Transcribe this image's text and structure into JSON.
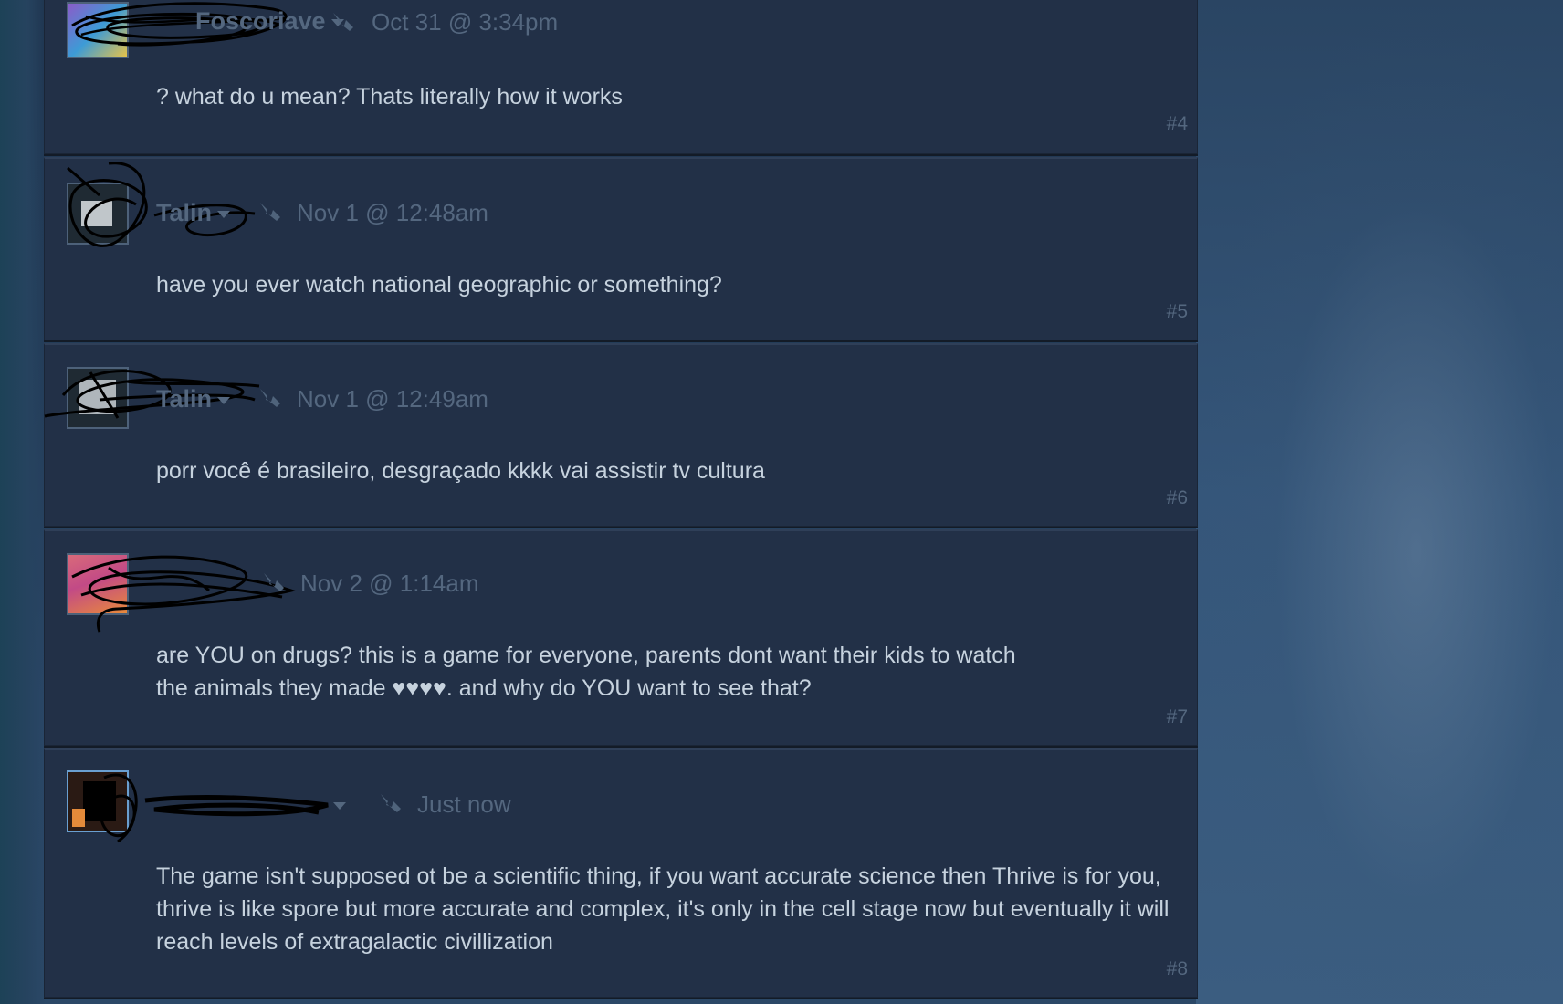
{
  "posts": [
    {
      "author": "Foscoriave",
      "timestamp": "Oct 31 @ 3:34pm",
      "text": "? what do u mean? Thats literally how it works",
      "number": "#4",
      "avatar_color": "#8a5cc9"
    },
    {
      "author": "Talin",
      "timestamp": "Nov 1 @ 12:48am",
      "text": "have you ever watch national geographic or something?",
      "number": "#5",
      "avatar_color": "#1f2a33"
    },
    {
      "author": "Talin",
      "timestamp": "Nov 1 @ 12:49am",
      "text": "porr você é brasileiro, desgraçado kkkk vai assistir tv cultura",
      "number": "#6",
      "avatar_color": "#1f2a33"
    },
    {
      "author": "",
      "timestamp": "Nov 2 @ 1:14am",
      "text": "are YOU on drugs? this is a game for everyone, parents dont want their kids to watch the animals they made ♥♥♥♥. and why do YOU want to see that?",
      "number": "#7",
      "avatar_color": "#d96a7a"
    },
    {
      "author": "",
      "timestamp": "Just now",
      "text": "The game isn't supposed ot be a scientific thing, if you want accurate science then Thrive is for you, thrive is like spore but more accurate and complex, it's only in the cell stage now but eventually it will reach levels of extragalactic civillization",
      "number": "#8",
      "avatar_color": "#2a1a14"
    }
  ]
}
